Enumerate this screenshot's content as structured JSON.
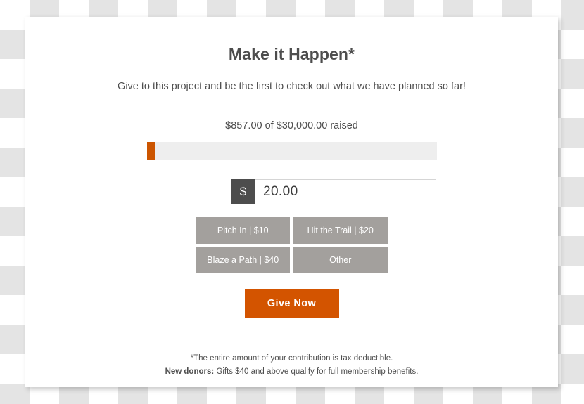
{
  "card": {
    "title": "Make it Happen*",
    "subtitle": "Give to this project and be the first to check out what we have planned so far!",
    "progress": {
      "raised_label": "$857.00 of $30,000.00 raised",
      "raised_amount": "$857.00",
      "goal_amount": "$30,000.00",
      "percent": 3,
      "fill_color": "#cc5500",
      "track_color": "#eeeeee"
    },
    "amount_field": {
      "currency_symbol": "$",
      "value": "20.00",
      "placeholder": "0.00"
    },
    "presets": [
      {
        "label": "Pitch In | $10"
      },
      {
        "label": "Hit the Trail | $20"
      },
      {
        "label": "Blaze a Path | $40"
      },
      {
        "label": "Other"
      }
    ],
    "submit": {
      "label": "Give Now",
      "color": "#d35400"
    },
    "footnotes": {
      "tax_note": "*The entire amount of your contribution is tax deductible.",
      "donors_label": "New donors:",
      "donors_note": " Gifts $40 and above qualify for full membership benefits."
    }
  }
}
